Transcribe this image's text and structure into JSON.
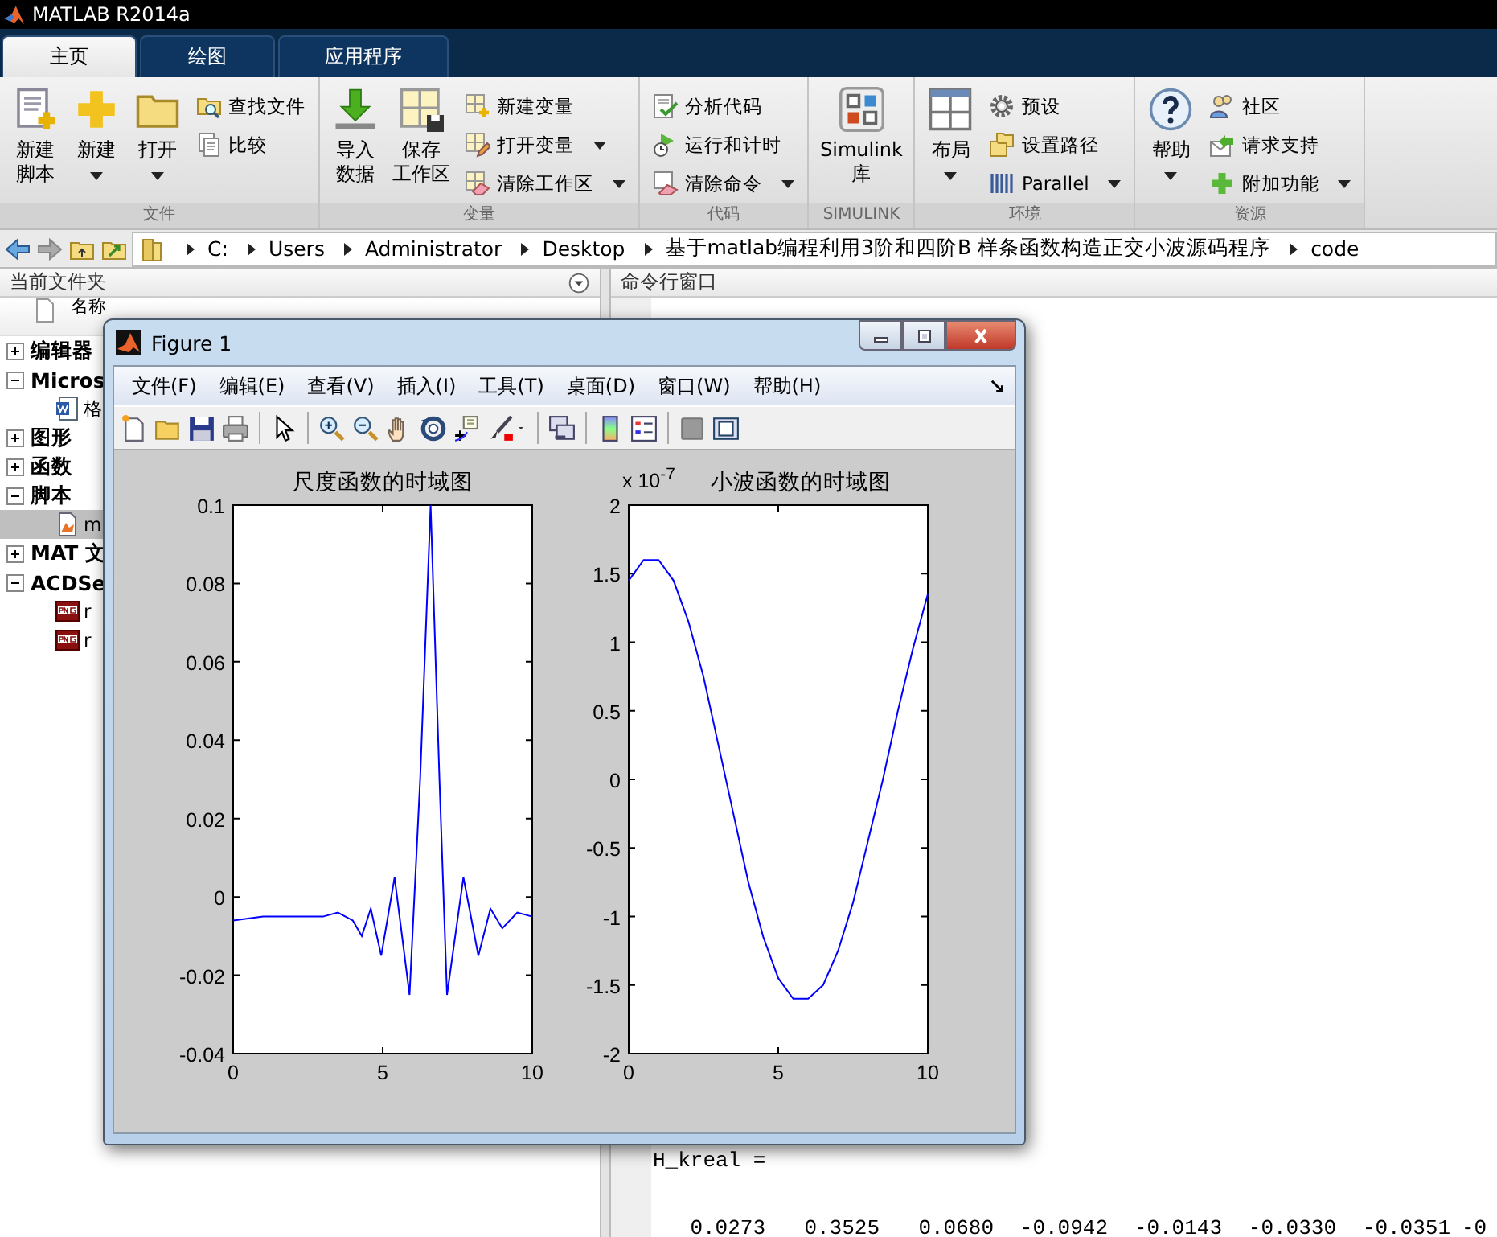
{
  "window": {
    "title": "MATLAB R2014a"
  },
  "tabs": [
    {
      "label": "主页",
      "selected": true
    },
    {
      "label": "绘图",
      "selected": false
    },
    {
      "label": "应用程序",
      "selected": false
    }
  ],
  "ribbon": {
    "groups": [
      {
        "label": "文件",
        "items": [
          {
            "kind": "large",
            "lines": [
              "新建",
              "脚本"
            ],
            "dropdown": false
          },
          {
            "kind": "large",
            "lines": [
              "新建"
            ],
            "dropdown": true
          },
          {
            "kind": "large",
            "lines": [
              "打开"
            ],
            "dropdown": true
          },
          {
            "kind": "stack",
            "items": [
              {
                "label": "查找文件",
                "dropdown": false
              },
              {
                "label": "比较",
                "dropdown": false
              }
            ]
          }
        ]
      },
      {
        "label": "变量",
        "items": [
          {
            "kind": "large",
            "lines": [
              "导入",
              "数据"
            ],
            "dropdown": false
          },
          {
            "kind": "large",
            "lines": [
              "保存",
              "工作区"
            ],
            "dropdown": false
          },
          {
            "kind": "stack",
            "items": [
              {
                "label": "新建变量",
                "dropdown": false
              },
              {
                "label": "打开变量",
                "dropdown": true
              },
              {
                "label": "清除工作区",
                "dropdown": true
              }
            ]
          }
        ]
      },
      {
        "label": "代码",
        "items": [
          {
            "kind": "stack",
            "items": [
              {
                "label": "分析代码",
                "dropdown": false
              },
              {
                "label": "运行和计时",
                "dropdown": false
              },
              {
                "label": "清除命令",
                "dropdown": true
              }
            ]
          }
        ]
      },
      {
        "label": "SIMULINK",
        "items": [
          {
            "kind": "large",
            "lines": [
              "Simulink",
              "库"
            ],
            "dropdown": false
          }
        ]
      },
      {
        "label": "环境",
        "items": [
          {
            "kind": "large",
            "lines": [
              "布局"
            ],
            "dropdown": true
          },
          {
            "kind": "stack",
            "items": [
              {
                "label": "预设",
                "dropdown": false
              },
              {
                "label": "设置路径",
                "dropdown": false
              },
              {
                "label": "Parallel",
                "dropdown": true
              }
            ]
          }
        ]
      },
      {
        "label": "资源",
        "items": [
          {
            "kind": "large",
            "lines": [
              "帮助"
            ],
            "dropdown": true
          },
          {
            "kind": "stack",
            "items": [
              {
                "label": "社区",
                "dropdown": false
              },
              {
                "label": "请求支持",
                "dropdown": false
              },
              {
                "label": "附加功能",
                "dropdown": true
              }
            ]
          }
        ]
      }
    ]
  },
  "address_bar": {
    "path": [
      "C:",
      "Users",
      "Administrator",
      "Desktop",
      "基于matlab编程利用3阶和四阶B 样条函数构造正交小波源码程序",
      "code"
    ]
  },
  "current_folder": {
    "title": "当前文件夹",
    "column_header": "名称",
    "tree": [
      {
        "label": "编辑器",
        "expanded": false
      },
      {
        "label": "Micros",
        "expanded": true,
        "children": [
          {
            "kind": "word",
            "label": "格",
            "selected": false
          }
        ]
      },
      {
        "label": "图形",
        "expanded": false
      },
      {
        "label": "函数",
        "expanded": false
      },
      {
        "label": "脚本",
        "expanded": true,
        "children": [
          {
            "kind": "script",
            "label": "m",
            "selected": true
          }
        ]
      },
      {
        "label": "MAT 文",
        "expanded": false
      },
      {
        "label": "ACDSe",
        "expanded": true,
        "children": [
          {
            "kind": "png",
            "label": "r",
            "selected": false
          },
          {
            "kind": "png",
            "label": "r",
            "selected": false
          }
        ]
      }
    ]
  },
  "command_window": {
    "title": "命令行窗口",
    "lines": [
      {
        "kind": "text",
        "text": "H_kreal ="
      },
      {
        "kind": "values",
        "values": [
          "0.0273",
          "0.3525",
          "0.0680",
          "-0.0942",
          "-0.0143",
          "-0.0330",
          "-0.0351",
          "-0"
        ]
      }
    ]
  },
  "figure": {
    "title": "Figure 1",
    "menu": [
      "文件(F)",
      "编辑(E)",
      "查看(V)",
      "插入(I)",
      "工具(T)",
      "桌面(D)",
      "窗口(W)",
      "帮助(H)"
    ],
    "charts": [
      {
        "chart_data": {
          "type": "line",
          "title": "尺度函数的时域图",
          "x": [
            0,
            1,
            2,
            3,
            3.5,
            4,
            4.3,
            4.6,
            4.95,
            5.4,
            5.9,
            6.25,
            6.6,
            6.9,
            7.15,
            7.7,
            8.2,
            8.6,
            9.0,
            9.5,
            10
          ],
          "series": [
            {
              "color": "#0000ff",
              "values": [
                -0.006,
                -0.005,
                -0.005,
                -0.005,
                -0.004,
                -0.006,
                -0.01,
                -0.003,
                -0.015,
                0.005,
                -0.025,
                0.03,
                0.1,
                0.03,
                -0.025,
                0.005,
                -0.015,
                -0.003,
                -0.008,
                -0.004,
                -0.005
              ]
            }
          ],
          "xlim": [
            0,
            10
          ],
          "ylim": [
            -0.04,
            0.1
          ],
          "xticks": [
            0,
            5,
            10
          ],
          "yticks": [
            -0.04,
            -0.02,
            0,
            0.02,
            0.04,
            0.06,
            0.08,
            0.1
          ]
        }
      },
      {
        "chart_data": {
          "type": "line",
          "title": "小波函数的时域图",
          "x": [
            0,
            0.5,
            1,
            1.5,
            2,
            2.5,
            3,
            3.5,
            4,
            4.5,
            5,
            5.5,
            6,
            6.5,
            7,
            7.5,
            8,
            8.5,
            9,
            9.5,
            10
          ],
          "series": [
            {
              "color": "#0000ff",
              "values": [
                1.45,
                1.6,
                1.6,
                1.45,
                1.15,
                0.75,
                0.25,
                -0.25,
                -0.75,
                -1.15,
                -1.45,
                -1.6,
                -1.6,
                -1.5,
                -1.25,
                -0.9,
                -0.45,
                0.0,
                0.5,
                0.95,
                1.35
              ]
            }
          ],
          "xlim": [
            0,
            10
          ],
          "ylim": [
            -2,
            2
          ],
          "xticks": [
            0,
            5,
            10
          ],
          "yticks": [
            -2,
            -1.5,
            -1,
            -0.5,
            0,
            0.5,
            1,
            1.5,
            2
          ],
          "annotations": [
            {
              "text": "x 10$^{-7}$"
            }
          ]
        }
      }
    ]
  }
}
